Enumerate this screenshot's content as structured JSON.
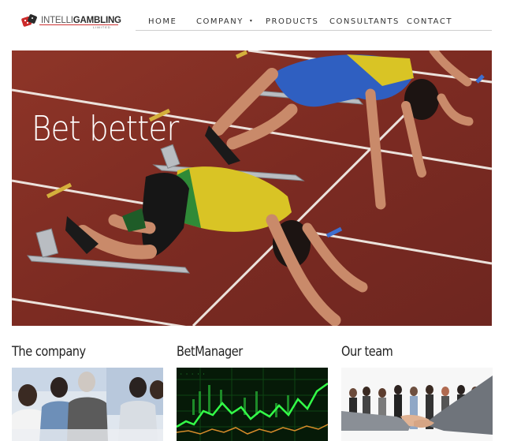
{
  "brand": {
    "logo_primary": "INTELLI",
    "logo_secondary": "GAMBLING",
    "logo_sub": "LIMITED",
    "logo_icon": "dice-icon"
  },
  "nav": {
    "items": [
      {
        "label": "HOME"
      },
      {
        "label": "COMPANY",
        "has_dropdown": true
      },
      {
        "label": "PRODUCTS"
      },
      {
        "label": "CONSULTANTS"
      },
      {
        "label": "CONTACT"
      }
    ],
    "dropdown_icon": "chevron-down-icon"
  },
  "hero": {
    "headline": "Bet better",
    "image": "sprinters-in-starting-blocks"
  },
  "sections": [
    {
      "title": "The company",
      "image": "business-team-meeting"
    },
    {
      "title": "BetManager",
      "image": "stock-chart-green"
    },
    {
      "title": "Our team",
      "image": "team-handshake"
    }
  ],
  "colors": {
    "track": "#8a3027",
    "hero_text": "#ffffff",
    "chart_green": "#27d63b",
    "logo_red": "#cc2a2a"
  }
}
